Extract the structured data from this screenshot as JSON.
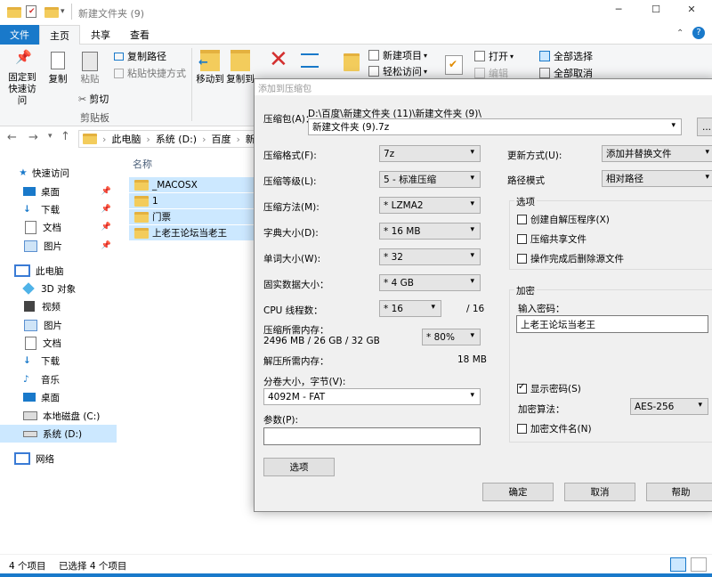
{
  "window": {
    "title": "新建文件夹 (9)",
    "controls": [
      "─",
      "☐",
      "✕"
    ]
  },
  "ribbon": {
    "tabs": [
      {
        "label": "文件"
      },
      {
        "label": "主页"
      },
      {
        "label": "共享"
      },
      {
        "label": "查看"
      }
    ],
    "pin_label": "固定到快速访问",
    "copy_label": "复制",
    "paste_label": "粘贴",
    "copy_path_label": "复制路径",
    "paste_shortcut_label": "粘贴快捷方式",
    "cut_label": "剪切",
    "clipboard_group": "剪贴板",
    "move_to_label": "移动到",
    "copy_to_label": "复制到",
    "new_item_label": "新建项目",
    "easy_access_label": "轻松访问",
    "open_label": "打开",
    "edit_label": "编辑",
    "select_all_label": "全部选择",
    "select_none_label": "全部取消"
  },
  "address": {
    "crumbs": [
      "此电脑",
      "系统 (D:)",
      "百度",
      "新"
    ]
  },
  "filelist": {
    "header": "名称",
    "files": [
      "_MACOSX",
      "1",
      "门票",
      "上老王论坛当老王"
    ]
  },
  "nav": {
    "items": [
      {
        "label": "快速访问",
        "icon": "star-icon"
      },
      {
        "label": "桌面",
        "icon": "desktop-icon"
      },
      {
        "label": "下载",
        "icon": "download-icon"
      },
      {
        "label": "文档",
        "icon": "document-icon"
      },
      {
        "label": "图片",
        "icon": "picture-icon"
      },
      {
        "label": "此电脑",
        "icon": "computer-icon"
      },
      {
        "label": "3D 对象",
        "icon": "cube-icon"
      },
      {
        "label": "视频",
        "icon": "video-icon"
      },
      {
        "label": "图片",
        "icon": "picture-icon"
      },
      {
        "label": "文档",
        "icon": "document-icon"
      },
      {
        "label": "下载",
        "icon": "download-icon"
      },
      {
        "label": "音乐",
        "icon": "music-icon"
      },
      {
        "label": "桌面",
        "icon": "desktop-icon"
      },
      {
        "label": "本地磁盘 (C:)",
        "icon": "drive-icon"
      },
      {
        "label": "系统 (D:)",
        "icon": "drive-icon"
      },
      {
        "label": "网络",
        "icon": "network-icon"
      }
    ]
  },
  "status": {
    "count": "4 个项目",
    "selected": "已选择 4 个项目"
  },
  "dialog": {
    "title": "添加到压缩包",
    "archive_label": "压缩包(A)：",
    "archive_path": "D:\\百度\\新建文件夹 (11)\\新建文件夹 (9)\\",
    "archive_name": "新建文件夹 (9).7z",
    "browse_label": "...",
    "format_label": "压缩格式(F):",
    "format_value": "7z",
    "level_label": "压缩等级(L):",
    "level_value": "5 - 标准压缩",
    "method_label": "压缩方法(M):",
    "method_value": "* LZMA2",
    "dict_label": "字典大小(D):",
    "dict_value": "* 16 MB",
    "word_label": "单词大小(W):",
    "word_value": "* 32",
    "solid_label": "固实数据大小：",
    "solid_value": "* 4 GB",
    "threads_label": "CPU 线程数：",
    "threads_value": "* 16",
    "threads_total": "/ 16",
    "mem_label": "压缩所需内存：",
    "mem_value": "2496 MB / 26 GB / 32 GB",
    "mem_percent": "* 80%",
    "decomp_label": "解压所需内存：",
    "decomp_value": "18 MB",
    "split_label": "分卷大小，字节(V):",
    "split_value": "4092M - FAT",
    "params_label": "参数(P):",
    "params_value": "",
    "options_button": "选项",
    "update_label": "更新方式(U):",
    "update_value": "添加并替换文件",
    "pathmode_label": "路径模式",
    "pathmode_value": "相对路径",
    "options_group": "选项",
    "opt_sfx": "创建自解压程序(X)",
    "opt_shared": "压缩共享文件",
    "opt_delete": "操作完成后删除源文件",
    "encrypt_group": "加密",
    "password_label": "输入密码：",
    "password_value": "上老王论坛当老王",
    "show_password": "显示密码(S)",
    "enc_method_label": "加密算法：",
    "enc_method_value": "AES-256",
    "encrypt_names": "加密文件名(N)",
    "ok": "确定",
    "cancel": "取消",
    "help": "帮助"
  },
  "colors": {
    "accent": "#1979ca",
    "selection": "#cce8ff",
    "folder": "#f3cc5c",
    "delete_red": "#d32f2f",
    "dialog_bg": "#f0f0f0"
  }
}
